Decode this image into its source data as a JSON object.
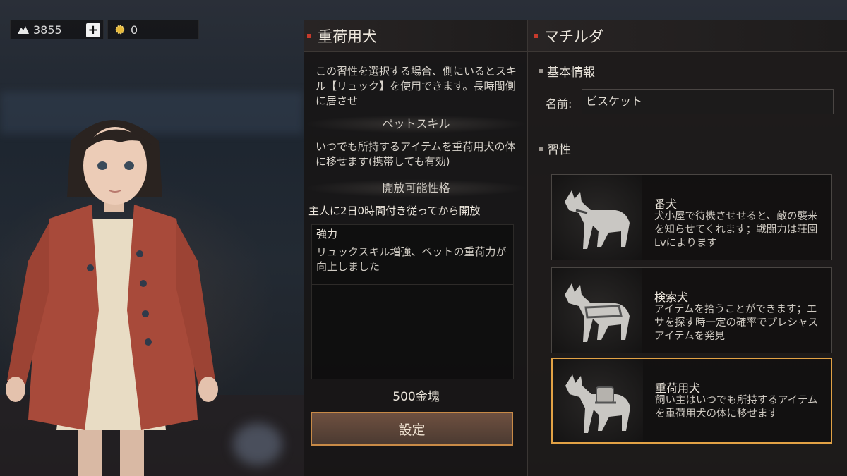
{
  "currency": {
    "silver_icon": "silver-pile-icon",
    "silver_amount": "3855",
    "add_icon": "plus-icon",
    "gold_icon": "gold-coin-icon",
    "gold_amount": "0"
  },
  "middle_panel": {
    "title": "重荷用犬",
    "description": "この習性を選択する場合、側にいるとスキル【リュック】を使用できます。長時間側に居させ",
    "pet_skill_heading": "ペットスキル",
    "pet_skill_text": "いつでも所持するアイテムを重荷用犬の体に移せます(携帯しても有効)",
    "unlockable_heading": "開放可能性格",
    "unlock_condition": "主人に2日0時間付き従ってから開放",
    "trait_name": "強力",
    "trait_text": "リュックスキル増強、ペットの重荷力が向上しました",
    "price": "500金塊",
    "set_button": "設定"
  },
  "right_panel": {
    "title": "マチルダ",
    "basic_info_heading": "基本情報",
    "name_label": "名前:",
    "name_value": "ビスケット",
    "habits_heading": "習性",
    "habits": [
      {
        "name": "番犬",
        "desc": "犬小屋で待機させせると、敵の襲来を知らせてくれます；戦闘力は荘園Lvによります",
        "icon": "guard-dog-icon",
        "selected": false
      },
      {
        "name": "検索犬",
        "desc": "アイテムを拾うことができます；エサを探す時一定の確率でプレシャスアイテムを発見",
        "icon": "search-dog-icon",
        "selected": false
      },
      {
        "name": "重荷用犬",
        "desc": "飼い主はいつでも所持するアイテムを重荷用犬の体に移せます",
        "icon": "pack-dog-icon",
        "selected": true
      }
    ]
  },
  "colors": {
    "accent_red": "#c63a2c",
    "selected_border": "#e2a245",
    "button_border": "#c88a47"
  }
}
